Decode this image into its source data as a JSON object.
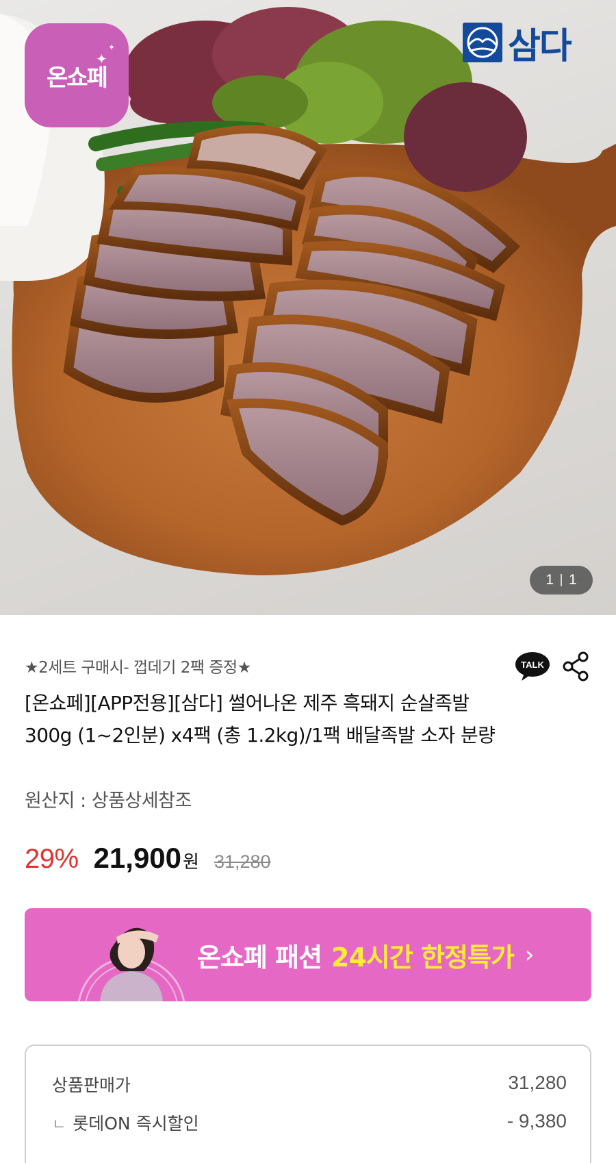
{
  "hero": {
    "onshope_logo_text": "온쇼페",
    "brand_logo_text": "삼다",
    "counter": {
      "current": "1",
      "total": "1"
    }
  },
  "product": {
    "promo": "★2세트 구매시- 껍데기 2팩 증정★",
    "title": "[온쇼페][APP전용][삼다] 썰어나온 제주 흑돼지 순살족발 300g (1~2인분) x4팩 (총 1.2kg)/1팩 배달족발 소자 분량",
    "origin": "원산지 : 상품상세참조",
    "talk_label": "TALK"
  },
  "price": {
    "discount": "29%",
    "sale_price": "21,900",
    "currency": "원",
    "original_price": "31,280"
  },
  "banner": {
    "text_main": "온쇼페 패션",
    "text_highlight": "24시간 한정특가",
    "chevron": "›",
    "bg_color": "#e568c4",
    "highlight_color": "#fdec38"
  },
  "breakdown": {
    "rows": [
      {
        "label": "상품판매가",
        "value": "31,280"
      },
      {
        "label": "롯데ON 즉시할인",
        "value": "- 9,380"
      }
    ],
    "branch_glyph": "ㄴ"
  },
  "colors": {
    "discount_red": "#e0322e",
    "brand_blue": "#134a9a",
    "onshope_pink": "#c95fb6"
  }
}
